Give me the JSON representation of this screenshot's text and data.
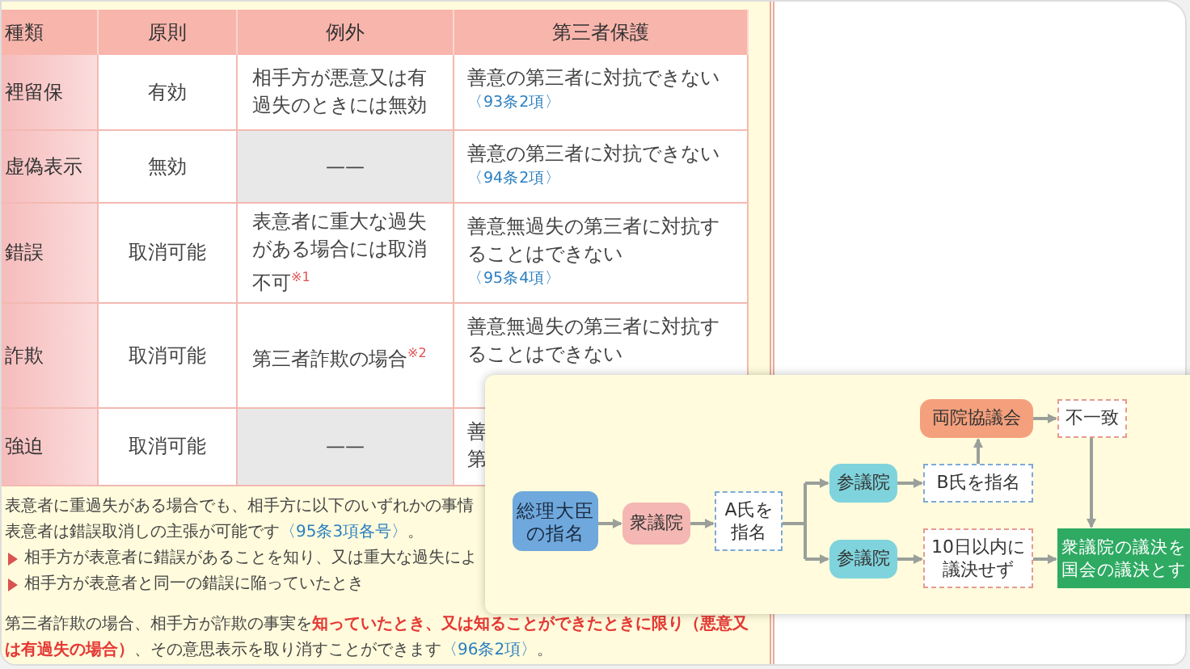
{
  "table": {
    "columns": [
      "種類",
      "原則",
      "例外",
      "第三者保護"
    ],
    "rows": [
      {
        "type": "裡留保",
        "principle": "有効",
        "exception": {
          "text": "相手方が悪意又は有過失のときには無効",
          "shaded": false
        },
        "protection": {
          "lines": [
            "善意の第三者に対抗できない"
          ],
          "ref": "〈93条2項〉"
        }
      },
      {
        "type": "虚偽表示",
        "principle": "無効",
        "exception": {
          "text": "——",
          "shaded": true
        },
        "protection": {
          "lines": [
            "善意の第三者に対抗できない"
          ],
          "ref": "〈94条2項〉"
        }
      },
      {
        "type": "錯誤",
        "principle": "取消可能",
        "exception": {
          "text": "表意者に重大な過失がある場合には取消不可$^{※1}$",
          "shaded": false
        },
        "protection": {
          "lines": [
            "善意無過失の第三者に対抗す",
            "ることはできない"
          ],
          "ref": "〈95条4項〉"
        }
      },
      {
        "type": "詐欺",
        "principle": "取消可能",
        "exception": {
          "text": "第三者詐欺の場合$^{※2}$",
          "shaded": false
        },
        "protection": {
          "lines": [
            "善意無過失の第三者に対抗す",
            "ることはできない"
          ]
        }
      },
      {
        "type": "強迫",
        "principle": "取消可能",
        "exception": {
          "text": "——",
          "shaded": true
        },
        "protection": {
          "lines": [
            "善",
            "第"
          ]
        }
      }
    ]
  },
  "notes": [
    {
      "kind": "plain",
      "segments": [
        {
          "kind": "plain",
          "text": "表意者に重過失がある場合でも、相手方に以下のいずれかの事情"
        }
      ]
    },
    {
      "kind": "plain",
      "segments": [
        {
          "kind": "plain",
          "text": "表意者は錯誤取消しの主張が可能です"
        },
        {
          "kind": "ref",
          "text": "〈95条3項各号〉"
        },
        {
          "kind": "plain",
          "text": "。"
        }
      ]
    },
    {
      "kind": "bullet",
      "segments": [
        {
          "kind": "plain",
          "text": "相手方が表意者に錯誤があることを知り、又は重大な過失によ"
        }
      ]
    },
    {
      "kind": "bullet",
      "segments": [
        {
          "kind": "plain",
          "text": "相手方が表意者と同一の錯誤に陥っていたとき"
        }
      ]
    },
    {
      "kind": "plain",
      "segments": [
        {
          "kind": "plain",
          "text": "第三者詐欺の場合、相手方が詐欺の事実を"
        },
        {
          "kind": "emphasis",
          "text": "知っていたとき、又は知ることができたときに限り（悪意又は有過失の場合）"
        },
        {
          "kind": "plain",
          "text": "、その意思表示を取り消すことができます"
        },
        {
          "kind": "ref",
          "text": "〈96条2項〉"
        },
        {
          "kind": "plain",
          "text": "。"
        }
      ]
    }
  ],
  "flowchart": {
    "nodes": [
      {
        "kind": "council",
        "lines": [
          "両院協議会"
        ]
      },
      {
        "kind": "outcome",
        "lines": [
          "不一致"
        ]
      },
      {
        "kind": "house2",
        "lines": [
          "参議院"
        ]
      },
      {
        "kind": "result",
        "lines": [
          "B氏を指名"
        ]
      },
      {
        "kind": "start",
        "lines": [
          "総理大臣",
          "の指名"
        ]
      },
      {
        "kind": "house",
        "lines": [
          "衆議院"
        ]
      },
      {
        "kind": "result",
        "lines": [
          "A氏を",
          "指名"
        ]
      },
      {
        "kind": "house2",
        "lines": [
          "参議院"
        ]
      },
      {
        "kind": "outcome",
        "lines": [
          "10日以内に",
          "議決せず"
        ]
      },
      {
        "kind": "final",
        "lines": [
          "衆議院の議決を",
          "国会の議決とす"
        ]
      }
    ]
  }
}
